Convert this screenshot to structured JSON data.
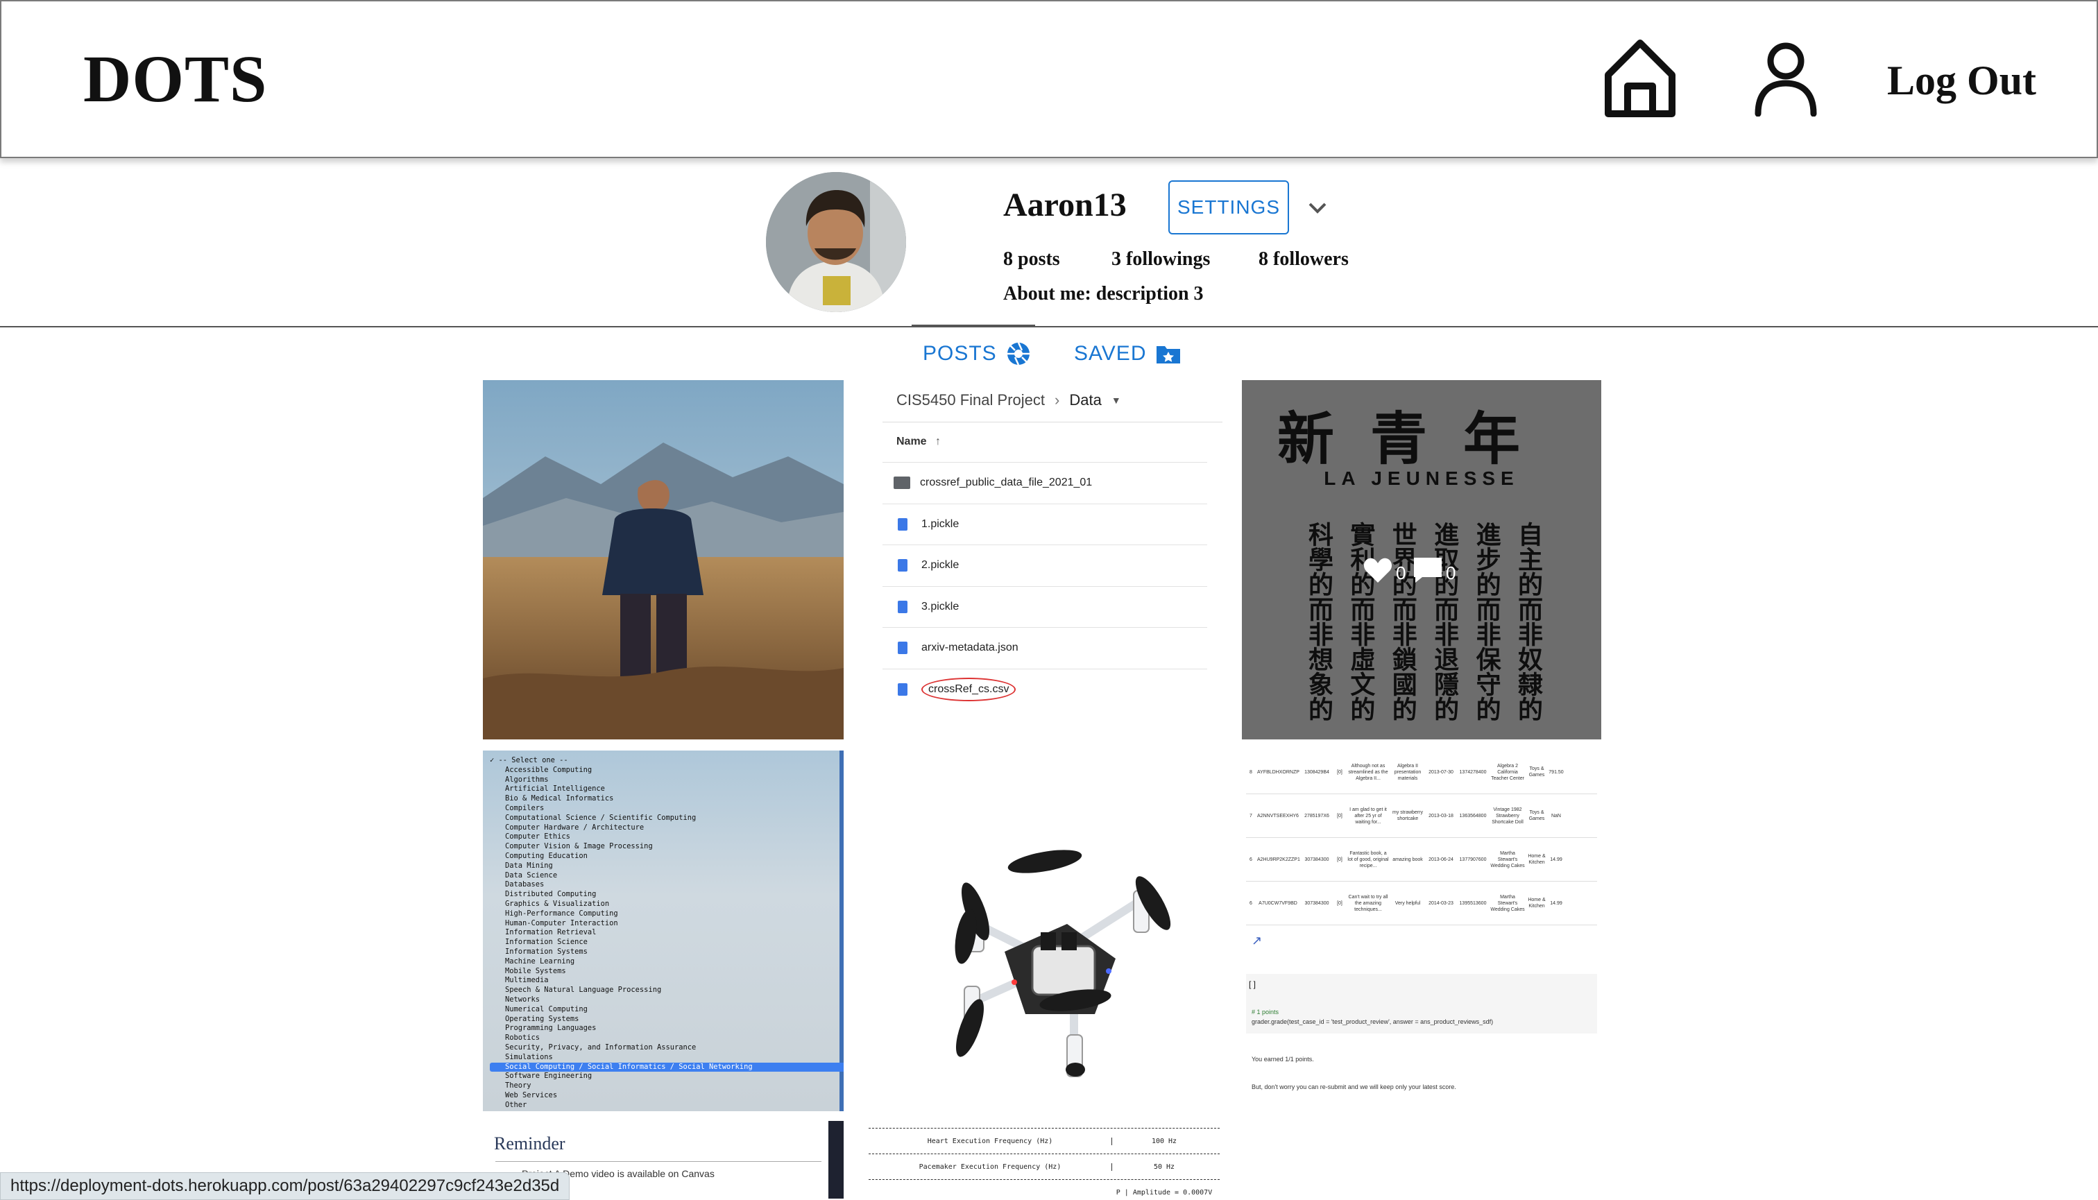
{
  "header": {
    "logo": "DOTS",
    "logout_label": "Log Out"
  },
  "profile": {
    "username": "Aaron13",
    "settings_label": "SETTINGS",
    "posts": "8 posts",
    "followings": "3 followings",
    "followers": "8 followers",
    "about": "About me: description 3"
  },
  "tabs": [
    {
      "label": "POSTS",
      "icon": "camera-aperture-icon",
      "active": true
    },
    {
      "label": "SAVED",
      "icon": "saved-folder-star-icon",
      "active": false
    }
  ],
  "posts": {
    "drive": {
      "breadcrumb_root": "CIS5450 Final Project",
      "breadcrumb_current": "Data",
      "column_name": "Name",
      "files": [
        {
          "name": "crossref_public_data_file_2021_01",
          "type": "folder"
        },
        {
          "name": "1.pickle",
          "type": "file"
        },
        {
          "name": "2.pickle",
          "type": "file"
        },
        {
          "name": "3.pickle",
          "type": "file"
        },
        {
          "name": "arxiv-metadata.json",
          "type": "file"
        },
        {
          "name": "crossRef_cs.csv",
          "type": "file"
        }
      ]
    },
    "magazine": {
      "title": "新青年",
      "subtitle": "LA JEUNESSE",
      "columns": [
        "自主的而非奴隸的",
        "進步的而非保守的",
        "進取的而非退隱的",
        "世界的而非鎖國的",
        "實利的而非虛文的",
        "科學的而非想象的"
      ],
      "likes": "0",
      "comments": "0"
    },
    "select_list": {
      "options": [
        "-- Select one --",
        "Accessible Computing",
        "Algorithms",
        "Artificial Intelligence",
        "Bio & Medical Informatics",
        "Compilers",
        "Computational Science / Scientific Computing",
        "Computer Hardware / Architecture",
        "Computer Ethics",
        "Computer Vision & Image Processing",
        "Computing Education",
        "Data Mining",
        "Data Science",
        "Databases",
        "Distributed Computing",
        "Graphics & Visualization",
        "High-Performance Computing",
        "Human-Computer Interaction",
        "Information Retrieval",
        "Information Science",
        "Information Systems",
        "Machine Learning",
        "Mobile Systems",
        "Multimedia",
        "Speech & Natural Language Processing",
        "Networks",
        "Numerical Computing",
        "Operating Systems",
        "Programming Languages",
        "Robotics",
        "Security, Privacy, and Information Assurance",
        "Simulations",
        "Social Computing / Social Informatics / Social Networking",
        "Software Engineering",
        "Theory",
        "Web Services",
        "Other"
      ],
      "highlighted": "Social Computing / Social Informatics / Social Networking"
    },
    "notebook": {
      "rows": [
        [
          "8",
          "AYFBLDHXORNZP",
          "1308429B4",
          "[0]",
          "Although not as streamlined as the Algebra II...",
          "Algebra II presentation materials",
          "2013-07-30",
          "1374278400",
          "Algebra 2 California Teacher Center",
          "Toys & Games",
          "791.50"
        ],
        [
          "7",
          "A2NNVTSEEXHY6",
          "2785197X6",
          "[0]",
          "I am glad to get it after 25 yr of waiting for...",
          "my strawberry shortcake",
          "2013-03-18",
          "1363564800",
          "Vintage 1982 Strawberry Shortcake Doll",
          "Toys & Games",
          "NaN"
        ],
        [
          "6",
          "A2HU9RP2K2ZZP1",
          "307384300",
          "[0]",
          "Fantastic book, a lot of good, original recipe...",
          "amazing book",
          "2013-06-24",
          "1377907600",
          "Martha Stewart's Wedding Cakes",
          "Home & Kitchen",
          "14.99"
        ],
        [
          "6",
          "A7U0CW7VF9BD",
          "307384300",
          "[0]",
          "Can't wait to try all the amazing techniques...",
          "Very helpful",
          "2014-03-23",
          "1395513600",
          "Martha Stewart's Wedding Cakes",
          "Home & Kitchen",
          "14.99"
        ]
      ],
      "comment": "# 1 points",
      "code": "grader.grade(test_case_id = 'test_product_review', answer = ans_product_reviews_sdf)",
      "output1": "You earned 1/1 points.",
      "output2": "But, don't worry you can re-submit and we will keep only your latest score."
    },
    "reminder": {
      "title": "Reminder",
      "line": "Project A Demo video is available on Canvas"
    },
    "freq_table": {
      "rows": [
        [
          "Heart Execution Frequency (Hz)",
          "100 Hz"
        ],
        [
          "Pacemaker Execution Frequency (Hz)",
          "50 Hz"
        ],
        [
          "",
          "P | Amplitude = 0.0007V"
        ]
      ]
    }
  },
  "status_bar": "https://deployment-dots.herokuapp.com/post/63a29402297c9cf243e2d35d",
  "colors": {
    "accent": "#1976d2",
    "overlay": "rgba(0,0,0,0.5)"
  }
}
